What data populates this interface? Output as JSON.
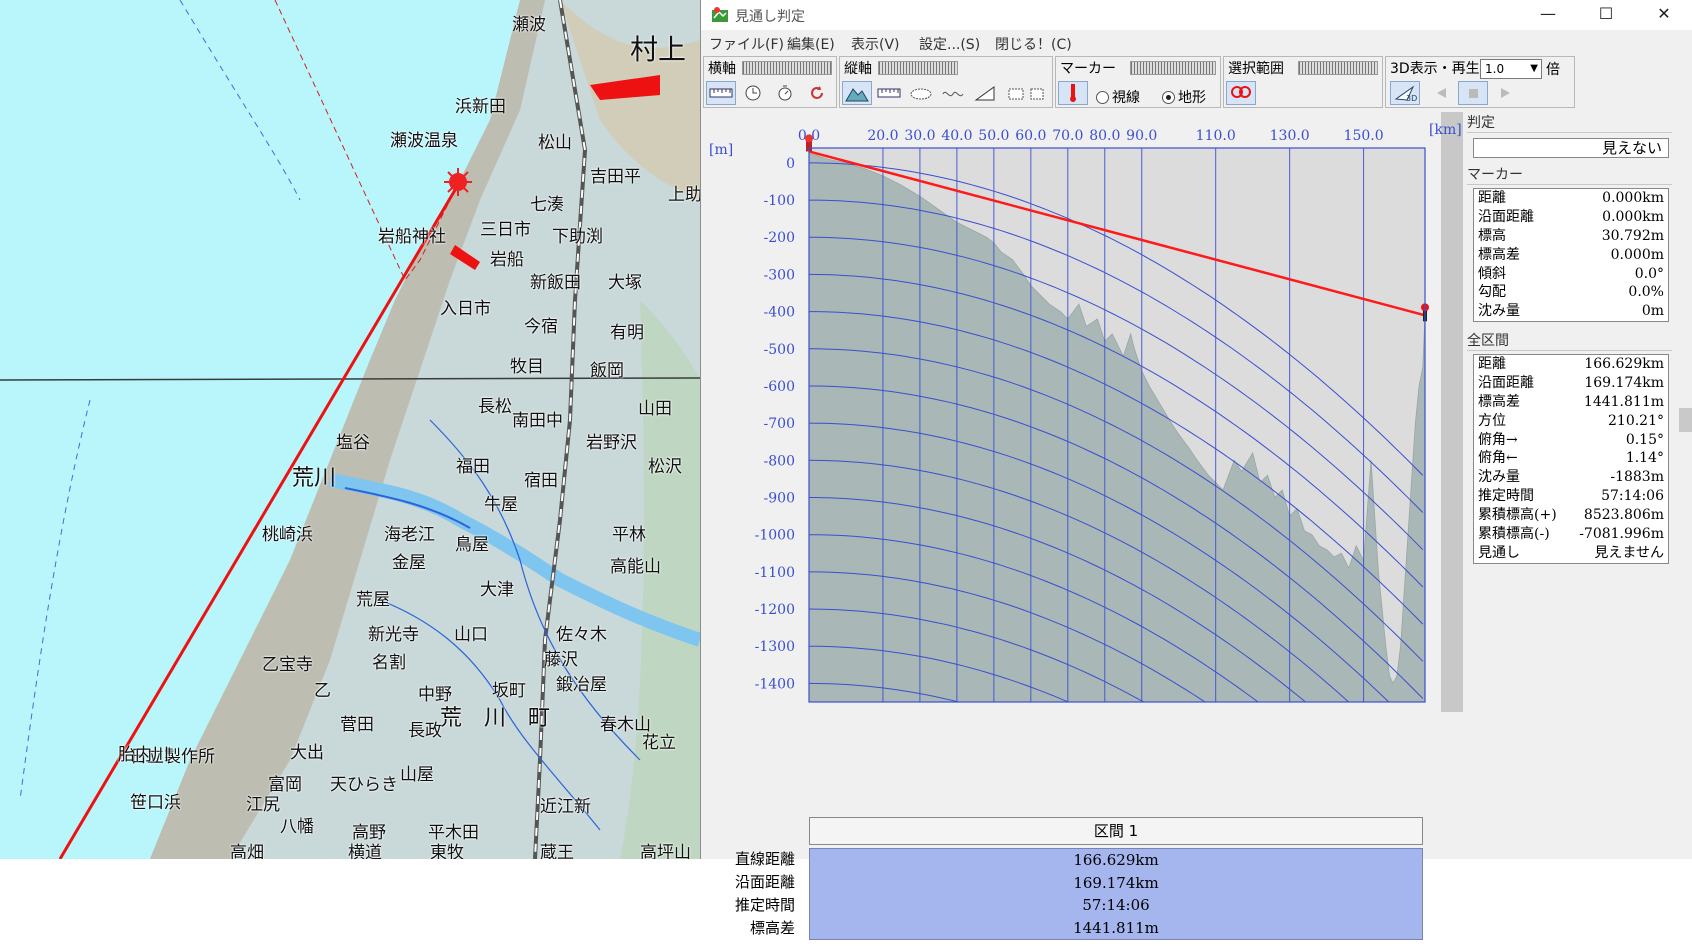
{
  "map": {
    "places": [
      {
        "text": "村上",
        "size": "big"
      },
      {
        "text": "瀬波",
        "size": "n"
      },
      {
        "text": "浜新田",
        "size": "n"
      },
      {
        "text": "瀬波温泉",
        "size": "n"
      },
      {
        "text": "松山",
        "size": "n"
      },
      {
        "text": "吉田平",
        "size": "n"
      },
      {
        "text": "上助",
        "size": "n"
      },
      {
        "text": "七湊",
        "size": "n"
      },
      {
        "text": "三日市",
        "size": "n"
      },
      {
        "text": "下助渕",
        "size": "n"
      },
      {
        "text": "岩船",
        "size": "n"
      },
      {
        "text": "岩船神社",
        "size": "n"
      },
      {
        "text": "新飯田",
        "size": "n"
      },
      {
        "text": "大塚",
        "size": "n"
      },
      {
        "text": "入日市",
        "size": "n"
      },
      {
        "text": "今宿",
        "size": "n"
      },
      {
        "text": "有明",
        "size": "n"
      },
      {
        "text": "牧目",
        "size": "n"
      },
      {
        "text": "飯岡",
        "size": "n"
      },
      {
        "text": "長松",
        "size": "n"
      },
      {
        "text": "南田中",
        "size": "n"
      },
      {
        "text": "山田",
        "size": "n"
      },
      {
        "text": "塩谷",
        "size": "n"
      },
      {
        "text": "岩野沢",
        "size": "n"
      },
      {
        "text": "荒川",
        "size": "med"
      },
      {
        "text": "福田",
        "size": "n"
      },
      {
        "text": "宿田",
        "size": "n"
      },
      {
        "text": "松沢",
        "size": "n"
      },
      {
        "text": "牛屋",
        "size": "n"
      },
      {
        "text": "桃崎浜",
        "size": "n"
      },
      {
        "text": "海老江",
        "size": "n"
      },
      {
        "text": "平林",
        "size": "n"
      },
      {
        "text": "金屋",
        "size": "n"
      },
      {
        "text": "鳥屋",
        "size": "n"
      },
      {
        "text": "高能山",
        "size": "n"
      },
      {
        "text": "大津",
        "size": "n"
      },
      {
        "text": "荒屋",
        "size": "n"
      },
      {
        "text": "新光寺",
        "size": "n"
      },
      {
        "text": "山口",
        "size": "n"
      },
      {
        "text": "佐々木",
        "size": "n"
      },
      {
        "text": "乙宝寺",
        "size": "n"
      },
      {
        "text": "名割",
        "size": "n"
      },
      {
        "text": "藤沢",
        "size": "n"
      },
      {
        "text": "鍛冶屋",
        "size": "n"
      },
      {
        "text": "乙",
        "size": "n"
      },
      {
        "text": "中野",
        "size": "n"
      },
      {
        "text": "坂町",
        "size": "n"
      },
      {
        "text": "荒　川　町",
        "size": "med"
      },
      {
        "text": "春木山",
        "size": "n"
      },
      {
        "text": "菅田",
        "size": "n"
      },
      {
        "text": "長政",
        "size": "n"
      },
      {
        "text": "花立",
        "size": "n"
      },
      {
        "text": "日立製作所",
        "size": "n"
      },
      {
        "text": "胎内川",
        "size": "n"
      },
      {
        "text": "大出",
        "size": "n"
      },
      {
        "text": "山屋",
        "size": "n"
      },
      {
        "text": "笹口浜",
        "size": "n"
      },
      {
        "text": "富岡",
        "size": "n"
      },
      {
        "text": "天ひらき",
        "size": "n"
      },
      {
        "text": "江尻",
        "size": "n"
      },
      {
        "text": "近江新",
        "size": "n"
      },
      {
        "text": "八幡",
        "size": "n"
      },
      {
        "text": "高野",
        "size": "n"
      },
      {
        "text": "平木田",
        "size": "n"
      },
      {
        "text": "高畑",
        "size": "n"
      },
      {
        "text": "横道",
        "size": "n"
      },
      {
        "text": "東牧",
        "size": "n"
      },
      {
        "text": "蔵王",
        "size": "n"
      },
      {
        "text": "高坪山",
        "size": "n"
      }
    ]
  },
  "window": {
    "title": "見通し判定",
    "controls": {
      "minimize": "—",
      "maximize": "☐",
      "close": "✕"
    },
    "menu": [
      "ファイル(F)",
      "編集(E)",
      "表示(V)",
      "設定...(S)",
      "閉じる！(C)"
    ],
    "toolbar": {
      "horizontal_axis": "横軸",
      "vertical_axis": "縦軸",
      "marker": "マーカー",
      "radio_sightline": "視線",
      "radio_terrain": "地形",
      "radio_selected": "terrain",
      "selection_range": "選択範囲",
      "playback_3d": "3D表示・再生",
      "zoom_value": "1.0",
      "zoom_unit": "倍"
    }
  },
  "chart_data": {
    "type": "area",
    "xlabel": "[km]",
    "ylabel": "[m]",
    "x_ticks": [
      "0.0",
      "20.0",
      "30.0",
      "40.0",
      "50.0",
      "60.0",
      "70.0",
      "80.0",
      "90.0",
      "110.0",
      "130.0",
      "150.0"
    ],
    "y_ticks": [
      "0",
      "-100",
      "-200",
      "-300",
      "-400",
      "-500",
      "-600",
      "-700",
      "-800",
      "-900",
      "-1000",
      "-1100",
      "-1200",
      "-1300",
      "-1400"
    ],
    "xlim": [
      0,
      166.6
    ],
    "ylim": [
      -1450,
      40
    ],
    "terrain_color": "#a9b7b6",
    "sky_color": "#dcdcdc",
    "curve_color": "#3a4fd0",
    "sightline_color": "#ff1a1a",
    "terrain": {
      "x": [
        0,
        2,
        5,
        10,
        15,
        20,
        25,
        30,
        35,
        40,
        45,
        48,
        50,
        52,
        55,
        58,
        60,
        62,
        65,
        68,
        70,
        73,
        75,
        78,
        80,
        82,
        85,
        87,
        88,
        90,
        92,
        95,
        98,
        100,
        103,
        105,
        108,
        110,
        112,
        115,
        117,
        120,
        122,
        124,
        126,
        128,
        130,
        132,
        134,
        136,
        138,
        140,
        142,
        144,
        146,
        148,
        150,
        152,
        154,
        155,
        156,
        157,
        158,
        159,
        160,
        161,
        162,
        163,
        164,
        165,
        166,
        166.6
      ],
      "y": [
        25,
        20,
        10,
        0,
        -15,
        -35,
        -60,
        -90,
        -125,
        -160,
        -185,
        -200,
        -215,
        -240,
        -260,
        -300,
        -330,
        -350,
        -380,
        -400,
        -420,
        -380,
        -440,
        -420,
        -480,
        -460,
        -520,
        -460,
        -500,
        -560,
        -600,
        -650,
        -700,
        -730,
        -770,
        -800,
        -840,
        -860,
        -880,
        -800,
        -830,
        -780,
        -860,
        -840,
        -900,
        -880,
        -950,
        -930,
        -990,
        -1000,
        -1030,
        -1040,
        -1060,
        -1050,
        -1090,
        -1030,
        -1070,
        -800,
        -1100,
        -1200,
        -1300,
        -1380,
        -1400,
        -1380,
        -1300,
        -1150,
        -1000,
        -850,
        -700,
        -600,
        -550,
        -410
      ]
    },
    "sightline": {
      "x": [
        0,
        166.6
      ],
      "y": [
        30.792,
        -410
      ]
    },
    "curvature_lines": {
      "start_levels": [
        0,
        -100,
        -200,
        -300,
        -400,
        -500,
        -600,
        -700,
        -800,
        -900,
        -1000,
        -1100,
        -1200,
        -1300,
        -1400
      ],
      "k": 0.0305
    }
  },
  "segment": {
    "header": "区間 1",
    "labels": [
      "直線距離",
      "沿面距離",
      "推定時間",
      "標高差"
    ],
    "values": [
      "166.629km",
      "169.174km",
      "57:14:06",
      "1441.811m"
    ]
  },
  "panel": {
    "judgement_title": "判定",
    "judgement_value": "見えない",
    "marker_title": "マーカー",
    "marker_rows": [
      {
        "k": "距離",
        "v": "0.000km"
      },
      {
        "k": "沿面距離",
        "v": "0.000km"
      },
      {
        "k": "標高",
        "v": "30.792m"
      },
      {
        "k": "標高差",
        "v": "0.000m"
      },
      {
        "k": "傾斜",
        "v": "0.0°"
      },
      {
        "k": "勾配",
        "v": "0.0%"
      },
      {
        "k": "沈み量",
        "v": "0m"
      }
    ],
    "total_title": "全区間",
    "total_rows": [
      {
        "k": "距離",
        "v": "166.629km"
      },
      {
        "k": "沿面距離",
        "v": "169.174km"
      },
      {
        "k": "標高差",
        "v": "1441.811m"
      },
      {
        "k": "方位",
        "v": "210.21°"
      },
      {
        "k": "俯角→",
        "v": "0.15°"
      },
      {
        "k": "俯角←",
        "v": "1.14°"
      },
      {
        "k": "沈み量",
        "v": "-1883m"
      },
      {
        "k": "推定時間",
        "v": "57:14:06"
      },
      {
        "k": "累積標高(+)",
        "v": "8523.806m"
      },
      {
        "k": "累積標高(-)",
        "v": "-7081.996m"
      },
      {
        "k": "見通し",
        "v": "見えません"
      }
    ]
  }
}
